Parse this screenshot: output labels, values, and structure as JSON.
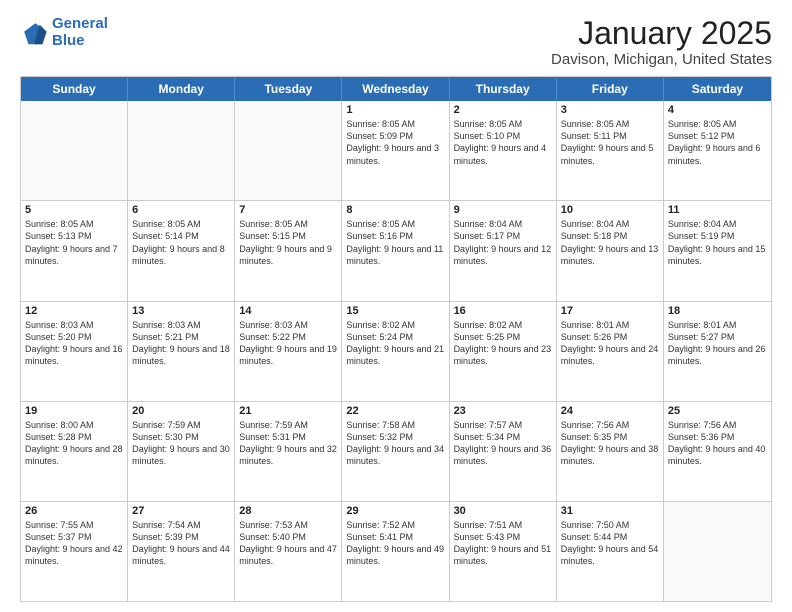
{
  "header": {
    "logo_line1": "General",
    "logo_line2": "Blue",
    "title": "January 2025",
    "location": "Davison, Michigan, United States"
  },
  "weekdays": [
    "Sunday",
    "Monday",
    "Tuesday",
    "Wednesday",
    "Thursday",
    "Friday",
    "Saturday"
  ],
  "weeks": [
    [
      {
        "day": "",
        "sunrise": "",
        "sunset": "",
        "daylight": ""
      },
      {
        "day": "",
        "sunrise": "",
        "sunset": "",
        "daylight": ""
      },
      {
        "day": "",
        "sunrise": "",
        "sunset": "",
        "daylight": ""
      },
      {
        "day": "1",
        "sunrise": "Sunrise: 8:05 AM",
        "sunset": "Sunset: 5:09 PM",
        "daylight": "Daylight: 9 hours and 3 minutes."
      },
      {
        "day": "2",
        "sunrise": "Sunrise: 8:05 AM",
        "sunset": "Sunset: 5:10 PM",
        "daylight": "Daylight: 9 hours and 4 minutes."
      },
      {
        "day": "3",
        "sunrise": "Sunrise: 8:05 AM",
        "sunset": "Sunset: 5:11 PM",
        "daylight": "Daylight: 9 hours and 5 minutes."
      },
      {
        "day": "4",
        "sunrise": "Sunrise: 8:05 AM",
        "sunset": "Sunset: 5:12 PM",
        "daylight": "Daylight: 9 hours and 6 minutes."
      }
    ],
    [
      {
        "day": "5",
        "sunrise": "Sunrise: 8:05 AM",
        "sunset": "Sunset: 5:13 PM",
        "daylight": "Daylight: 9 hours and 7 minutes."
      },
      {
        "day": "6",
        "sunrise": "Sunrise: 8:05 AM",
        "sunset": "Sunset: 5:14 PM",
        "daylight": "Daylight: 9 hours and 8 minutes."
      },
      {
        "day": "7",
        "sunrise": "Sunrise: 8:05 AM",
        "sunset": "Sunset: 5:15 PM",
        "daylight": "Daylight: 9 hours and 9 minutes."
      },
      {
        "day": "8",
        "sunrise": "Sunrise: 8:05 AM",
        "sunset": "Sunset: 5:16 PM",
        "daylight": "Daylight: 9 hours and 11 minutes."
      },
      {
        "day": "9",
        "sunrise": "Sunrise: 8:04 AM",
        "sunset": "Sunset: 5:17 PM",
        "daylight": "Daylight: 9 hours and 12 minutes."
      },
      {
        "day": "10",
        "sunrise": "Sunrise: 8:04 AM",
        "sunset": "Sunset: 5:18 PM",
        "daylight": "Daylight: 9 hours and 13 minutes."
      },
      {
        "day": "11",
        "sunrise": "Sunrise: 8:04 AM",
        "sunset": "Sunset: 5:19 PM",
        "daylight": "Daylight: 9 hours and 15 minutes."
      }
    ],
    [
      {
        "day": "12",
        "sunrise": "Sunrise: 8:03 AM",
        "sunset": "Sunset: 5:20 PM",
        "daylight": "Daylight: 9 hours and 16 minutes."
      },
      {
        "day": "13",
        "sunrise": "Sunrise: 8:03 AM",
        "sunset": "Sunset: 5:21 PM",
        "daylight": "Daylight: 9 hours and 18 minutes."
      },
      {
        "day": "14",
        "sunrise": "Sunrise: 8:03 AM",
        "sunset": "Sunset: 5:22 PM",
        "daylight": "Daylight: 9 hours and 19 minutes."
      },
      {
        "day": "15",
        "sunrise": "Sunrise: 8:02 AM",
        "sunset": "Sunset: 5:24 PM",
        "daylight": "Daylight: 9 hours and 21 minutes."
      },
      {
        "day": "16",
        "sunrise": "Sunrise: 8:02 AM",
        "sunset": "Sunset: 5:25 PM",
        "daylight": "Daylight: 9 hours and 23 minutes."
      },
      {
        "day": "17",
        "sunrise": "Sunrise: 8:01 AM",
        "sunset": "Sunset: 5:26 PM",
        "daylight": "Daylight: 9 hours and 24 minutes."
      },
      {
        "day": "18",
        "sunrise": "Sunrise: 8:01 AM",
        "sunset": "Sunset: 5:27 PM",
        "daylight": "Daylight: 9 hours and 26 minutes."
      }
    ],
    [
      {
        "day": "19",
        "sunrise": "Sunrise: 8:00 AM",
        "sunset": "Sunset: 5:28 PM",
        "daylight": "Daylight: 9 hours and 28 minutes."
      },
      {
        "day": "20",
        "sunrise": "Sunrise: 7:59 AM",
        "sunset": "Sunset: 5:30 PM",
        "daylight": "Daylight: 9 hours and 30 minutes."
      },
      {
        "day": "21",
        "sunrise": "Sunrise: 7:59 AM",
        "sunset": "Sunset: 5:31 PM",
        "daylight": "Daylight: 9 hours and 32 minutes."
      },
      {
        "day": "22",
        "sunrise": "Sunrise: 7:58 AM",
        "sunset": "Sunset: 5:32 PM",
        "daylight": "Daylight: 9 hours and 34 minutes."
      },
      {
        "day": "23",
        "sunrise": "Sunrise: 7:57 AM",
        "sunset": "Sunset: 5:34 PM",
        "daylight": "Daylight: 9 hours and 36 minutes."
      },
      {
        "day": "24",
        "sunrise": "Sunrise: 7:56 AM",
        "sunset": "Sunset: 5:35 PM",
        "daylight": "Daylight: 9 hours and 38 minutes."
      },
      {
        "day": "25",
        "sunrise": "Sunrise: 7:56 AM",
        "sunset": "Sunset: 5:36 PM",
        "daylight": "Daylight: 9 hours and 40 minutes."
      }
    ],
    [
      {
        "day": "26",
        "sunrise": "Sunrise: 7:55 AM",
        "sunset": "Sunset: 5:37 PM",
        "daylight": "Daylight: 9 hours and 42 minutes."
      },
      {
        "day": "27",
        "sunrise": "Sunrise: 7:54 AM",
        "sunset": "Sunset: 5:39 PM",
        "daylight": "Daylight: 9 hours and 44 minutes."
      },
      {
        "day": "28",
        "sunrise": "Sunrise: 7:53 AM",
        "sunset": "Sunset: 5:40 PM",
        "daylight": "Daylight: 9 hours and 47 minutes."
      },
      {
        "day": "29",
        "sunrise": "Sunrise: 7:52 AM",
        "sunset": "Sunset: 5:41 PM",
        "daylight": "Daylight: 9 hours and 49 minutes."
      },
      {
        "day": "30",
        "sunrise": "Sunrise: 7:51 AM",
        "sunset": "Sunset: 5:43 PM",
        "daylight": "Daylight: 9 hours and 51 minutes."
      },
      {
        "day": "31",
        "sunrise": "Sunrise: 7:50 AM",
        "sunset": "Sunset: 5:44 PM",
        "daylight": "Daylight: 9 hours and 54 minutes."
      },
      {
        "day": "",
        "sunrise": "",
        "sunset": "",
        "daylight": ""
      }
    ]
  ]
}
